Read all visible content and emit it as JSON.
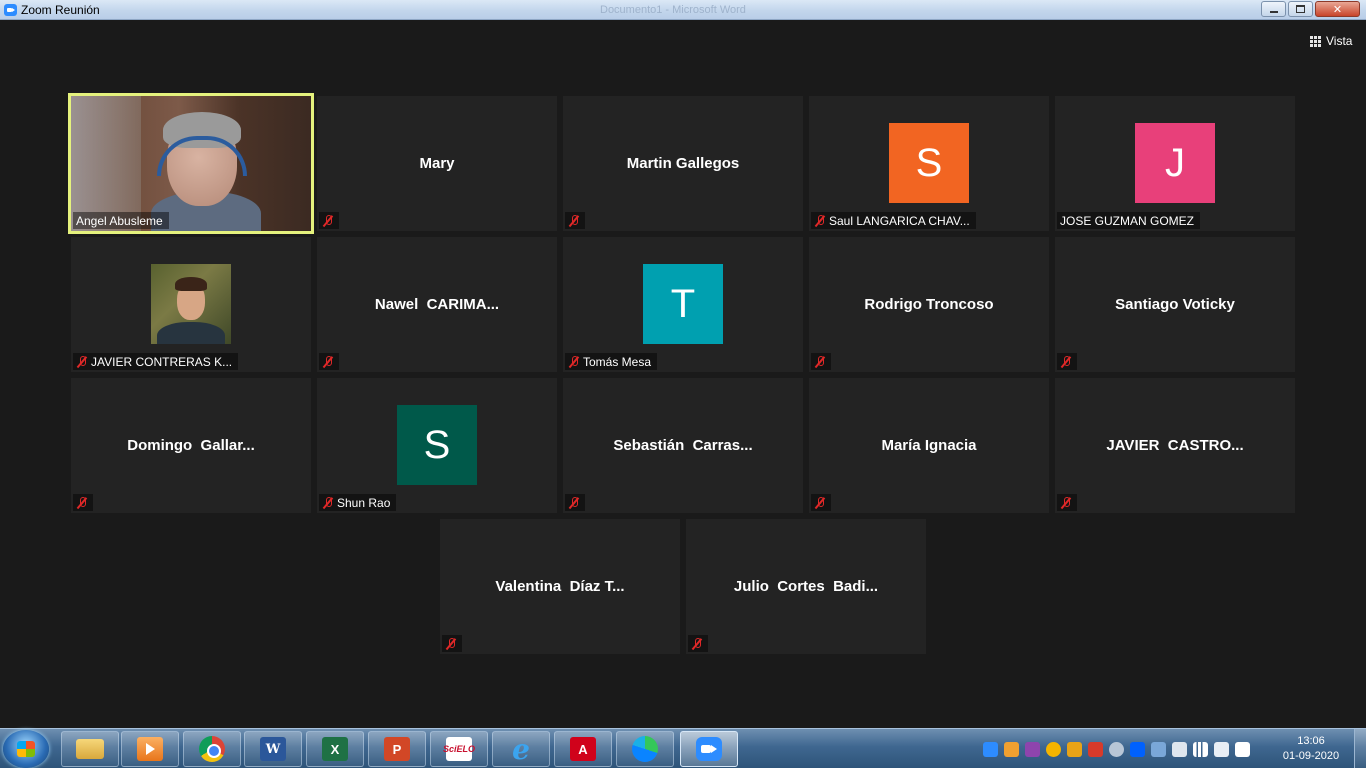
{
  "window": {
    "title": "Zoom Reunión",
    "background_title": "Documento1 - Microsoft Word"
  },
  "view_button": {
    "label": "Vista",
    "icon": "grid-icon"
  },
  "participants": [
    {
      "label": "Angel Abusleme",
      "display": "",
      "muted": false,
      "type": "video",
      "active_speaker": true
    },
    {
      "label": "",
      "display": "Mary",
      "muted": true,
      "type": "name"
    },
    {
      "label": "",
      "display": "Martin Gallegos",
      "muted": true,
      "type": "name"
    },
    {
      "label": "Saul LANGARICA CHAV...",
      "display": "",
      "muted": true,
      "type": "avatar",
      "avatar_letter": "S",
      "avatar_color": "#f26522"
    },
    {
      "label": "JOSE GUZMAN GOMEZ",
      "display": "",
      "muted": false,
      "type": "avatar",
      "avatar_letter": "J",
      "avatar_color": "#e8407a"
    },
    {
      "label": "JAVIER CONTRERAS K...",
      "display": "",
      "muted": true,
      "type": "photo"
    },
    {
      "label": "",
      "display": "Nawel  CARIMA...",
      "muted": true,
      "type": "name"
    },
    {
      "label": "Tomás Mesa",
      "display": "",
      "muted": true,
      "type": "avatar",
      "avatar_letter": "T",
      "avatar_color": "#00a0b0"
    },
    {
      "label": "",
      "display": "Rodrigo Troncoso",
      "muted": true,
      "type": "name"
    },
    {
      "label": "",
      "display": "Santiago Voticky",
      "muted": true,
      "type": "name"
    },
    {
      "label": "",
      "display": "Domingo  Gallar...",
      "muted": true,
      "type": "name"
    },
    {
      "label": "Shun Rao",
      "display": "",
      "muted": true,
      "type": "avatar",
      "avatar_letter": "S",
      "avatar_color": "#00594a"
    },
    {
      "label": "",
      "display": "Sebastián  Carras...",
      "muted": true,
      "type": "name"
    },
    {
      "label": "",
      "display": "María Ignacia",
      "muted": true,
      "type": "name"
    },
    {
      "label": "",
      "display": "JAVIER  CASTRO...",
      "muted": true,
      "type": "name"
    },
    {
      "label": "",
      "display": "Valentina  Díaz T...",
      "muted": true,
      "type": "name"
    },
    {
      "label": "",
      "display": "Julio  Cortes  Badi...",
      "muted": true,
      "type": "name"
    }
  ],
  "colors": {
    "background": "#1a1a1a",
    "tile": "#232323",
    "active_speaker_border": "#e5f27d",
    "muted_icon": "#e02828"
  },
  "taskbar": {
    "apps": [
      "explorer-icon",
      "media-player-icon",
      "chrome-icon",
      "word-icon",
      "excel-icon",
      "powerpoint-icon",
      "scielo-icon",
      "internet-explorer-icon",
      "acrobat-icon",
      "edge-icon",
      "zoom-icon"
    ],
    "active_app": "zoom-icon",
    "word_glyph": "W",
    "excel_glyph": "X",
    "ppt_glyph": "P",
    "scielo_glyph": "SciELO",
    "ie_glyph": "e",
    "acrobat_glyph": "A"
  },
  "clock": {
    "time": "13:06",
    "date": "01-09-2020"
  }
}
